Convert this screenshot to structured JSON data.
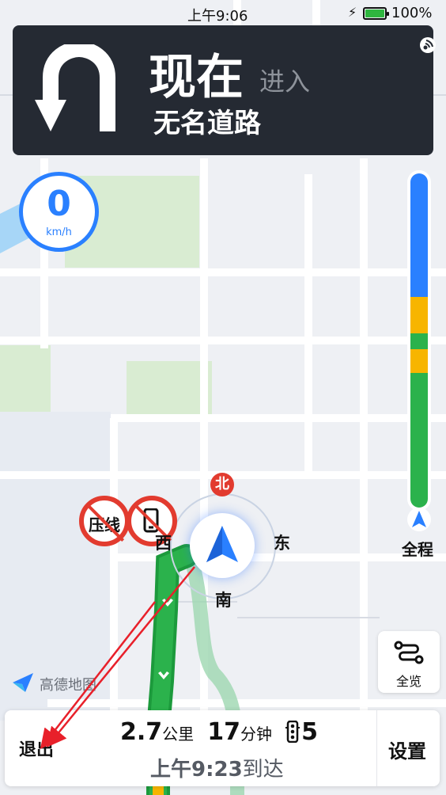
{
  "status_bar": {
    "time": "上午9:06",
    "battery": "100%",
    "battery_level": 1.0,
    "charging": true
  },
  "guidance": {
    "distance": "现在",
    "action": "进入",
    "road": "无名道路",
    "maneuver_icon": "u-turn-icon"
  },
  "speed": {
    "value": "0",
    "unit": "km/h"
  },
  "route_progress": {
    "label": "全程"
  },
  "compass": {
    "north": "北",
    "south": "南",
    "east": "东",
    "west": "西"
  },
  "road_signs": [
    {
      "label": "压线",
      "icon": "no-line-crossing-icon"
    },
    {
      "label": "",
      "icon": "no-phone-icon"
    }
  ],
  "overview_button": {
    "label": "全览"
  },
  "brand": {
    "name": "高德地图"
  },
  "trip": {
    "distance": "2.7",
    "distance_unit": "公里",
    "time": "17",
    "time_unit": "分钟",
    "traffic_lights": "5",
    "arrival_time": "上午9:23",
    "arrival_suffix": "到达"
  },
  "buttons": {
    "exit": "退出",
    "settings": "设置"
  },
  "colors": {
    "route_green": "#2bb24c",
    "route_blue": "#2a80ff",
    "route_yellow": "#f7b500",
    "alert_red": "#e23b2f"
  }
}
